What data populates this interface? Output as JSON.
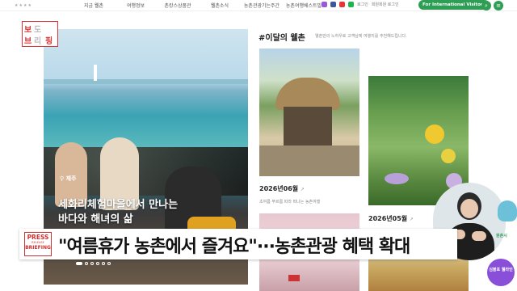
{
  "nav": {
    "logo": "★★★★",
    "items": [
      "지금 웰촌",
      "여행정보",
      "촌캉스상품관",
      "웰촌소식",
      "농촌관광기는주간",
      "농촌여행베스트빌"
    ],
    "login": "로그인",
    "signup": "회원회원 로그인",
    "intl_button": "For International Visitors",
    "colors": {
      "accent": "#2f9e55"
    }
  },
  "badge": {
    "chars": [
      "보",
      "도",
      "브",
      "리",
      "핑"
    ]
  },
  "hero": {
    "location": "제주",
    "title_line1": "세화리체험마을에서 만나는",
    "title_line2": "바다와 해녀의 삶",
    "slides_total": 6,
    "active_slide": 1
  },
  "monthly": {
    "title": "#이달의 웰촌",
    "desc": "웰촌만의 노하우로 고객님께 여행지를 추천해드립니다.",
    "card1": {
      "date": "2026년06월",
      "arrow": "↗",
      "subtitle": "초여름 푸르름 따라 떠나는 농촌여행"
    },
    "card2": {
      "date": "2026년05월",
      "arrow": "↗"
    }
  },
  "float": {
    "label": "원촌시",
    "button": "심볼포 웰라인"
  },
  "caption": {
    "press_l1": "PRESS",
    "press_l2": "RELEASE",
    "press_l3": "BRIEFING",
    "text": "\"여름휴가 농촌에서 즐겨요\"···농촌관광 혜택 확대"
  }
}
